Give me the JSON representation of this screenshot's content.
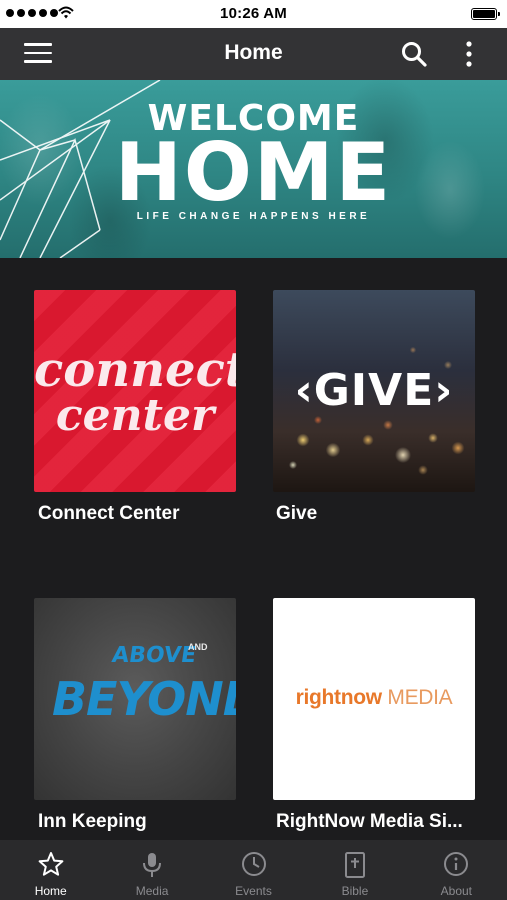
{
  "status_bar": {
    "time": "10:26 AM"
  },
  "nav": {
    "title": "Home"
  },
  "banner": {
    "line1": "WELCOME",
    "line2": "HOME",
    "tagline": "LIFE CHANGE HAPPENS HERE"
  },
  "tiles": [
    {
      "label": "Connect Center",
      "art_line1": "connect",
      "art_line2": "center"
    },
    {
      "label": "Give",
      "art_text": "‹GIVE›"
    },
    {
      "label": "Inn Keeping",
      "art_line1": "ABOVE",
      "art_small": "AND",
      "art_line2": "BEYOND"
    },
    {
      "label": "RightNow Media Si...",
      "art_brand": "rightnow",
      "art_brand2": " MEDIA"
    }
  ],
  "tabs": [
    {
      "label": "Home",
      "icon": "star-icon",
      "active": true
    },
    {
      "label": "Media",
      "icon": "microphone-icon",
      "active": false
    },
    {
      "label": "Events",
      "icon": "clock-icon",
      "active": false
    },
    {
      "label": "Bible",
      "icon": "bible-icon",
      "active": false
    },
    {
      "label": "About",
      "icon": "info-icon",
      "active": false
    }
  ],
  "colors": {
    "navbar": "#333335",
    "banner_teal": "#2e8583",
    "connect_red": "#e21931",
    "rightnow_orange": "#e8782a",
    "tab_inactive": "#8b8b8f"
  }
}
